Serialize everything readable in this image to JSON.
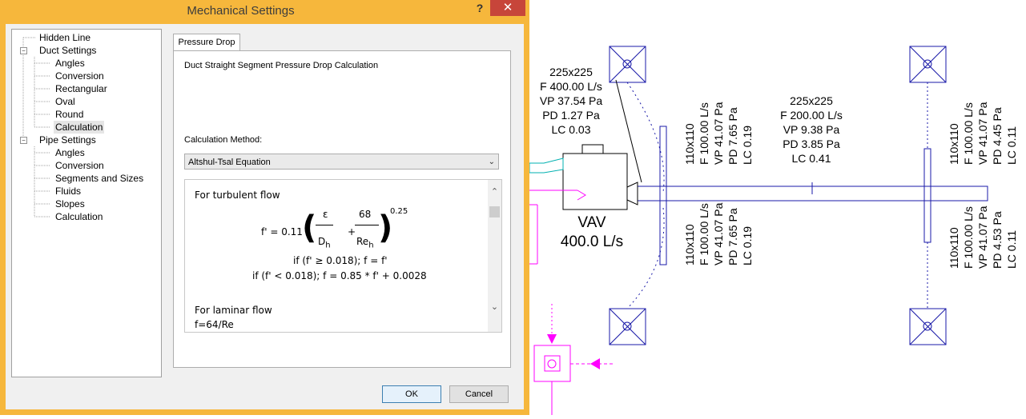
{
  "window": {
    "title": "Mechanical Settings",
    "help": "?",
    "close": "✕"
  },
  "tree": {
    "items": [
      {
        "label": "Hidden Line",
        "level": 1
      },
      {
        "label": "Duct Settings",
        "level": 0,
        "expander": "−"
      },
      {
        "label": "Angles",
        "level": 2
      },
      {
        "label": "Conversion",
        "level": 2
      },
      {
        "label": "Rectangular",
        "level": 2
      },
      {
        "label": "Oval",
        "level": 2
      },
      {
        "label": "Round",
        "level": 2
      },
      {
        "label": "Calculation",
        "level": 2,
        "selected": true
      },
      {
        "label": "Pipe Settings",
        "level": 0,
        "expander": "−"
      },
      {
        "label": "Angles",
        "level": 2
      },
      {
        "label": "Conversion",
        "level": 2
      },
      {
        "label": "Segments and Sizes",
        "level": 2
      },
      {
        "label": "Fluids",
        "level": 2
      },
      {
        "label": "Slopes",
        "level": 2
      },
      {
        "label": "Calculation",
        "level": 2
      }
    ]
  },
  "tab": {
    "label": "Pressure Drop"
  },
  "panel": {
    "heading": "Duct Straight Segment Pressure Drop Calculation",
    "method_label": "Calculation Method:",
    "method_value": "Altshul-Tsal Equation"
  },
  "formula": {
    "turbulent_heading": "For turbulent flow",
    "lhs": "f' = 0.11",
    "eps": "ε",
    "dh": "D",
    "dh_sub": "h",
    "plus": "+",
    "num68": "68",
    "re": "Re",
    "re_sub": "h",
    "exponent": "0.25",
    "cond1": "if (f' ≥ 0.018); f = f'",
    "cond2": "if (f' < 0.018); f = 0.85 * f' + 0.0028",
    "laminar_heading": "For laminar flow",
    "laminar_formula": "f=64/Re"
  },
  "buttons": {
    "ok": "OK",
    "cancel": "Cancel"
  },
  "drawing": {
    "colors": {
      "duct": "#1a1aa8",
      "text": "#000000",
      "pink": "#ff00ff",
      "cyan": "#00c0c0"
    },
    "main_duct_label": [
      "225x225",
      "F 200.00 L/s",
      "VP 9.38 Pa",
      "PD 3.85 Pa",
      "LC 0.41"
    ],
    "inlet_label": [
      "225x225",
      "F 400.00 L/s",
      "VP 37.54 Pa",
      "PD 1.27 Pa",
      "LC 0.03"
    ],
    "vav_label": [
      "VAV",
      "400.0 L/s"
    ],
    "branch_left_upper": [
      "110x110",
      "F 100.00 L/s",
      "VP 41.07 Pa",
      "PD 7.65 Pa",
      "LC 0.19"
    ],
    "branch_left_lower": [
      "110x110",
      "F 100.00 L/s",
      "VP 41.07 Pa",
      "PD 7.65 Pa",
      "LC 0.19"
    ],
    "branch_right_upper": [
      "110x110",
      "F 100.00 L/s",
      "VP 41.07 Pa",
      "PD 4.45 Pa",
      "LC 0.11"
    ],
    "branch_right_lower": [
      "110x110",
      "F 100.00 L/s",
      "VP 41.07 Pa",
      "PD 4.53 Pa",
      "LC 0.11"
    ]
  }
}
